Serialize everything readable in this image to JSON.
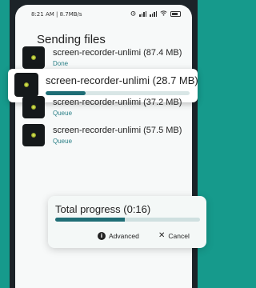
{
  "status_bar": {
    "time_speed": "8:21 AM | 8.7MB/s",
    "battery": "battery-icon",
    "wifi": "wifi-icon",
    "signal": "signal-icon"
  },
  "screen": {
    "title": "Sending files"
  },
  "files": [
    {
      "name": "screen-recorder-unlimi",
      "size": "(87.4 MB)",
      "status": "Done"
    },
    {
      "name": "screen-recorder-unlimi",
      "size": "(28.7 MB)",
      "status": "",
      "progress": 0.28
    },
    {
      "name": "screen-recorder-unlimi",
      "size": "(37.2 MB)",
      "status": "Queue"
    },
    {
      "name": "screen-recorder-unlimi",
      "size": "(57.5 MB)",
      "status": "Queue"
    }
  ],
  "total": {
    "title": "Total progress (0:16)",
    "progress": 0.48,
    "advanced_label": "Advanced",
    "cancel_label": "Cancel",
    "advanced_icon": "info-icon",
    "cancel_icon": "close-icon"
  },
  "colors": {
    "background": "#169a8c",
    "accent": "#1f6e76",
    "status_text": "#2a7f86"
  }
}
